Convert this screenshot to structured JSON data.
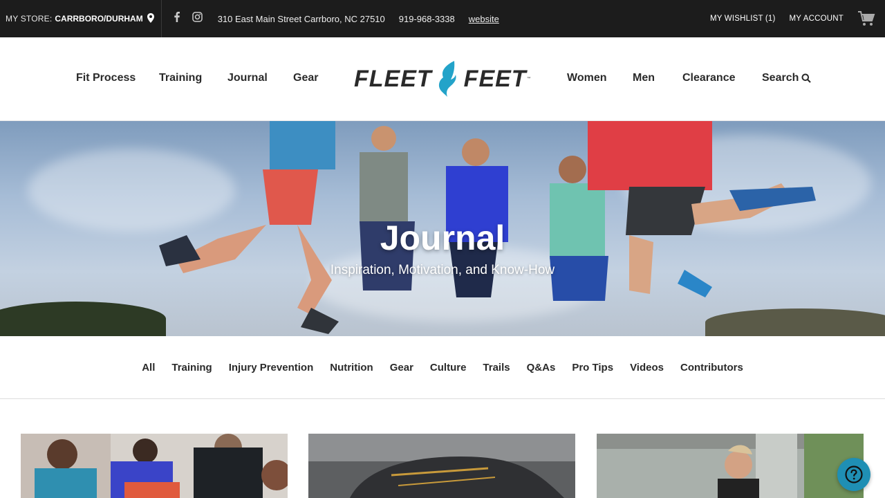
{
  "topbar": {
    "store_label": "MY STORE:",
    "store_name": "CARRBORO/DURHAM",
    "address": "310 East Main Street Carrboro, NC 27510",
    "phone": "919-968-3338",
    "website": "website",
    "wishlist": "MY WISHLIST (1)",
    "account": "MY ACCOUNT"
  },
  "nav": {
    "left": [
      "Fit Process",
      "Training",
      "Journal",
      "Gear"
    ],
    "right": [
      "Women",
      "Men",
      "Clearance",
      "Search"
    ],
    "logo_left": "FLEET",
    "logo_right": "FEET",
    "logo_tm": "™"
  },
  "hero": {
    "title": "Journal",
    "subtitle": "Inspiration, Motivation, and Know-How"
  },
  "categories": [
    "All",
    "Training",
    "Injury Prevention",
    "Nutrition",
    "Gear",
    "Culture",
    "Trails",
    "Q&As",
    "Pro Tips",
    "Videos",
    "Contributors"
  ],
  "colors": {
    "topbar_bg": "#1c1c1c",
    "accent": "#1f8fb4",
    "logo_blue": "#23a3c9"
  },
  "icons": {
    "location": "map-pin-icon",
    "facebook": "facebook-icon",
    "instagram": "instagram-icon",
    "cart": "shopping-cart-icon",
    "search": "search-icon",
    "help": "help-icon"
  }
}
